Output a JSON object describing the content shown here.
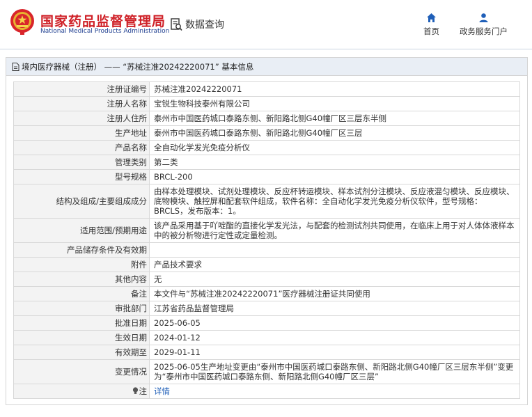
{
  "header": {
    "brand_cn": "国家药品监督管理局",
    "brand_en": "National Medical Products Administration",
    "query_label": "数据查询",
    "nav": [
      {
        "label": "首页",
        "icon": "home-icon"
      },
      {
        "label": "政务服务门户",
        "icon": "user-icon"
      }
    ]
  },
  "panel": {
    "title": "境内医疗器械（注册） —— “苏械注准20242220071” 基本信息"
  },
  "rows": [
    {
      "label": "注册证编号",
      "value": "苏械注准20242220071"
    },
    {
      "label": "注册人名称",
      "value": "宝锐生物科技泰州有限公司"
    },
    {
      "label": "注册人住所",
      "value": "泰州市中国医药城口泰路东侧、新阳路北侧G40幢厂区三层东半侧"
    },
    {
      "label": "生产地址",
      "value": "泰州市中国医药城口泰路东侧、新阳路北侧G40幢厂区三层"
    },
    {
      "label": "产品名称",
      "value": "全自动化学发光免疫分析仪"
    },
    {
      "label": "管理类别",
      "value": "第二类"
    },
    {
      "label": "型号规格",
      "value": "BRCL-200"
    },
    {
      "label": "结构及组成/主要组成成分",
      "value": "由样本处理模块、试剂处理模块、反应杯转运模块、样本试剂分注模块、反应液混匀模块、反应模块、底物模块、触控屏和配套软件组成，软件名称：全自动化学发光免疫分析仪软件，型号规格：BRCLS，发布版本：1。"
    },
    {
      "label": "适用范围/预期用途",
      "value": "该产品采用基于吖啶酯的直接化学发光法，与配套的检测试剂共同使用，在临床上用于对人体体液样本中的被分析物进行定性或定量检测。"
    },
    {
      "label": "产品储存条件及有效期",
      "value": ""
    },
    {
      "label": "附件",
      "value": "产品技术要求"
    },
    {
      "label": "其他内容",
      "value": "无"
    },
    {
      "label": "备注",
      "value": "本文件与“苏械注准20242220071”医疗器械注册证共同使用"
    },
    {
      "label": "审批部门",
      "value": "江苏省药品监督管理局"
    },
    {
      "label": "批准日期",
      "value": "2025-06-05"
    },
    {
      "label": "生效日期",
      "value": "2024-01-12"
    },
    {
      "label": "有效期至",
      "value": "2029-01-11"
    },
    {
      "label": "变更情况",
      "value": "2025-06-05生产地址变更由“泰州市中国医药城口泰路东侧、新阳路北侧G40幢厂区三层东半侧”变更为“泰州市中国医药城口泰路东侧、新阳路北侧G40幢厂区三层”"
    },
    {
      "label": "注",
      "value": "详情"
    }
  ],
  "colors": {
    "brand_red": "#cf2027",
    "brand_blue": "#1d3d8f",
    "link_blue": "#1f5fb8",
    "panel_head_bg": "#e9eef5"
  }
}
